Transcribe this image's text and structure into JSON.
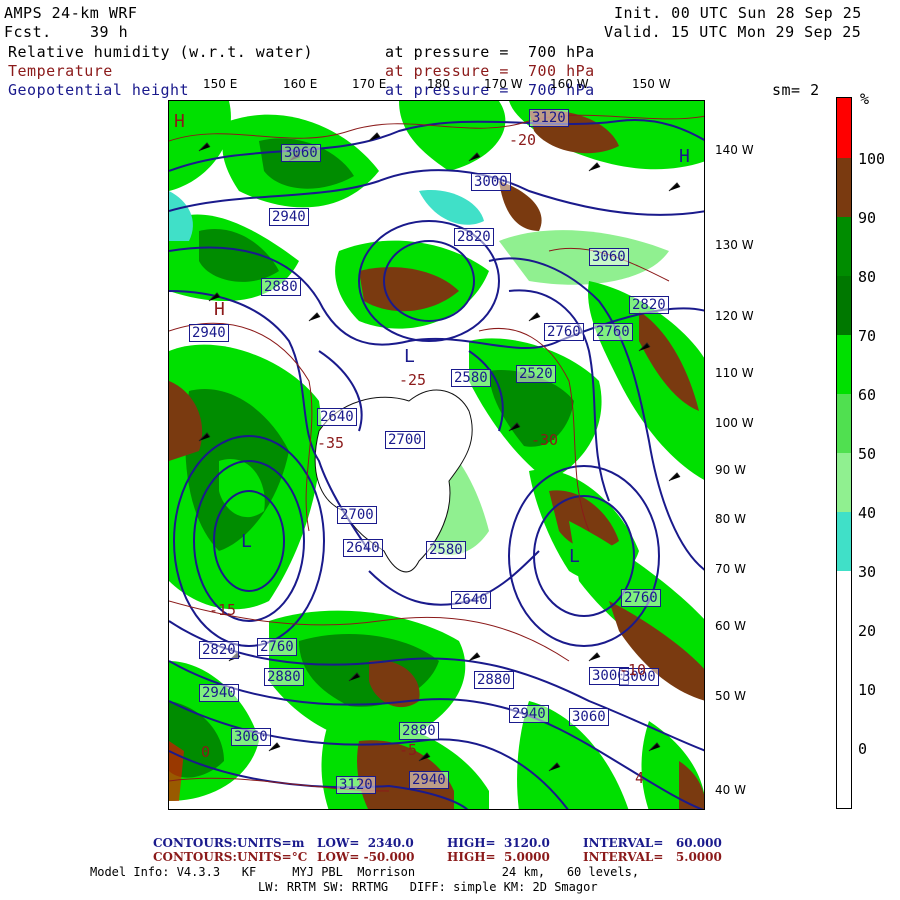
{
  "header": {
    "model": "AMPS 24-km WRF",
    "fcst_label": "Fcst.",
    "fcst_value": "39 h",
    "init": "Init. 00 UTC Sun 28 Sep 25",
    "valid": "Valid. 15 UTC Mon 29 Sep 25",
    "field1_name": "Relative humidity (w.r.t. water)",
    "field1_level": "at pressure =  700 hPa",
    "field2_name": "Temperature",
    "field2_level": "at pressure =  700 hPa",
    "field3_name": "Geopotential height",
    "field3_level": "at pressure =  700 hPa",
    "sm": "sm= 2"
  },
  "colors": {
    "navy": "#1a1a8c",
    "darkred": "#8b1a1a"
  },
  "lon_labels_top": [
    "150 E",
    "160 E",
    "170 E",
    "180",
    "170 W",
    "160 W",
    "150 W"
  ],
  "lat_labels_right": [
    "140 W",
    "130 W",
    "120 W",
    "110 W",
    "100 W",
    "90 W",
    "80 W",
    "70 W",
    "60 W",
    "50 W",
    "40 W"
  ],
  "colorbar": {
    "unit": "%",
    "bands": [
      {
        "range": "0-30",
        "color": "#ffffff"
      },
      {
        "range": "30-40",
        "color": "#40e0c8"
      },
      {
        "range": "40-50",
        "color": "#90f090"
      },
      {
        "range": "50-60",
        "color": "#50e050"
      },
      {
        "range": "60-70",
        "color": "#00e000"
      },
      {
        "range": "70-80",
        "color": "#007800"
      },
      {
        "range": "80-90",
        "color": "#008c00"
      },
      {
        "range": "90-100",
        "color": "#7a3a10"
      },
      {
        "range": "100+",
        "color": "#ff0000"
      }
    ],
    "labels": [
      "100",
      "90",
      "80",
      "70",
      "60",
      "50",
      "40",
      "30",
      "20",
      "10",
      "0"
    ]
  },
  "map_labels": {
    "height": [
      "3060",
      "2940",
      "2880",
      "3000",
      "2820",
      "3120",
      "3060",
      "2760",
      "2640",
      "2700",
      "2580",
      "2520",
      "2640",
      "2700",
      "2760",
      "2820",
      "2880",
      "2940",
      "3000",
      "3060",
      "2640",
      "2580",
      "2880",
      "2760",
      "2820",
      "2940",
      "3060",
      "3000",
      "3120",
      "2940",
      "2880",
      "2760",
      "2940"
    ],
    "temp": [
      "-35",
      "-30",
      "-25",
      "-20",
      "-15",
      "-10",
      "-5",
      "0",
      "4"
    ],
    "pressure_centers": [
      "H",
      "H",
      "L",
      "L",
      "L",
      "H"
    ]
  },
  "footer": {
    "c1_label": "CONTOURS:",
    "c1_units": "UNITS=m",
    "c1_low": "LOW=  2340.0",
    "c1_high": "HIGH=  3120.0",
    "c1_int": "INTERVAL=   60.000",
    "c2_label": "CONTOURS:",
    "c2_units": "UNITS=°C",
    "c2_low": "LOW= -50.000",
    "c2_high": "HIGH=  5.0000",
    "c2_int": "INTERVAL=   5.0000",
    "info1": "Model Info: V4.3.3   KF     MYJ PBL  Morrison            24 km,   60 levels,",
    "info2": "LW: RRTM SW: RRTMG   DIFF: simple KM: 2D Smagor"
  }
}
